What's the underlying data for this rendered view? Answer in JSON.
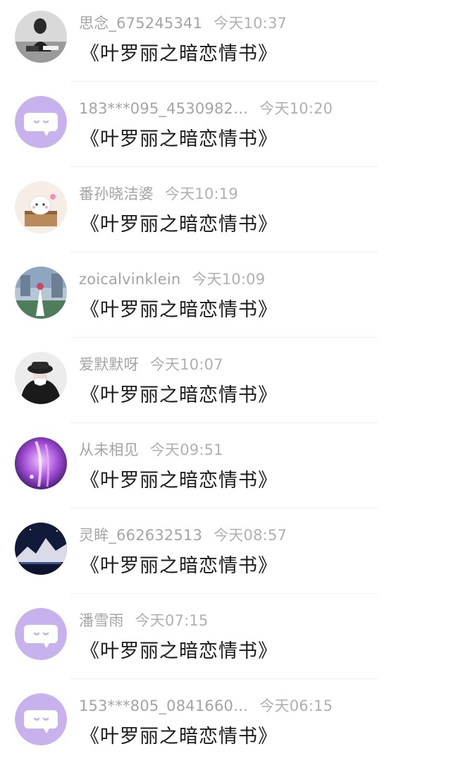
{
  "messages": [
    {
      "name": "思念_675245341",
      "time": "今天10:37",
      "text": "《叶罗丽之暗恋情书》",
      "avatar": "photo-dark"
    },
    {
      "name": "183***095_4530982…",
      "time": "今天10:20",
      "text": "《叶罗丽之暗恋情书》",
      "avatar": "default-chat"
    },
    {
      "name": "番孙晓洁婆",
      "time": "今天10:19",
      "text": "《叶罗丽之暗恋情书》",
      "avatar": "cartoon-bear"
    },
    {
      "name": "zoicalvinklein",
      "time": "今天10:09",
      "text": "《叶罗丽之暗恋情书》",
      "avatar": "photo-wedding"
    },
    {
      "name": "爱默默呀",
      "time": "今天10:07",
      "text": "《叶罗丽之暗恋情书》",
      "avatar": "photo-girl-hat"
    },
    {
      "name": "从未相见",
      "time": "今天09:51",
      "text": "《叶罗丽之暗恋情书》",
      "avatar": "anime-purple"
    },
    {
      "name": "灵眸_662632513",
      "time": "今天08:57",
      "text": "《叶罗丽之暗恋情书》",
      "avatar": "photo-mountain"
    },
    {
      "name": "潘雪雨",
      "time": "今天07:15",
      "text": "《叶罗丽之暗恋情书》",
      "avatar": "default-chat"
    },
    {
      "name": "153***805_0841660…",
      "time": "今天06:15",
      "text": "《叶罗丽之暗恋情书》",
      "avatar": "default-chat"
    }
  ]
}
